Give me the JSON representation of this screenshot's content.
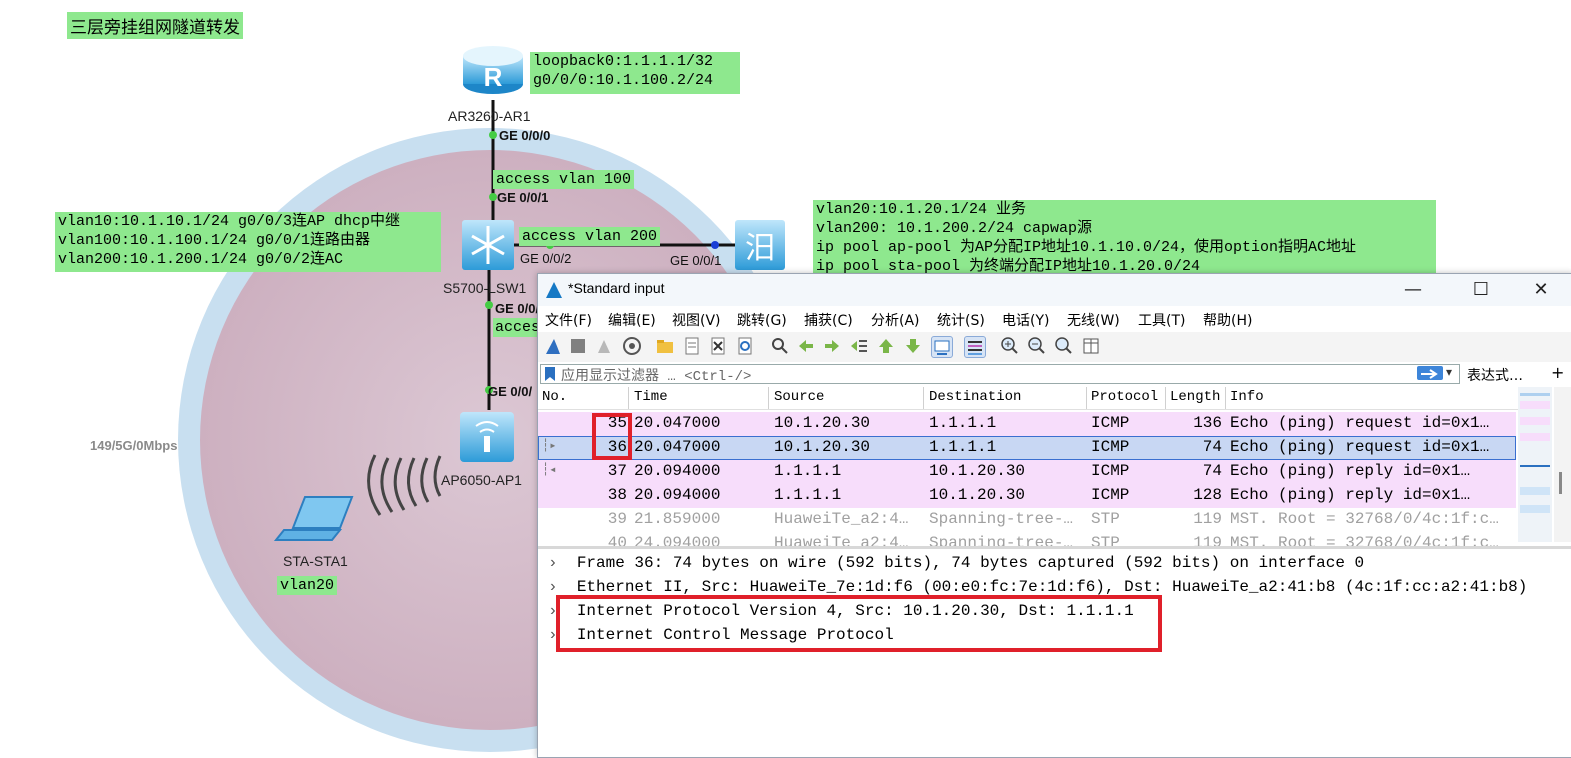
{
  "diagram": {
    "title": "三层旁挂组网隧道转发",
    "router": {
      "name": "AR3260-AR1",
      "config_lines": [
        "loopback0:1.1.1.1/32",
        "g0/0/0:10.1.100.2/24"
      ],
      "port": "GE 0/0/0"
    },
    "link_router_switch": {
      "label": "access vlan 100"
    },
    "switch": {
      "name": "S5700-LSW1",
      "port_up": "GE 0/0/1",
      "port_ac": "GE 0/0/2",
      "port_down": "GE 0/0/",
      "config_lines": [
        "vlan10:10.1.10.1/24 g0/0/3连AP dhcp中继",
        "vlan100:10.1.100.1/24 g0/0/1连路由器",
        "vlan200:10.1.200.1/24 g0/0/2连AC"
      ]
    },
    "link_switch_ac": {
      "label": "access vlan 200"
    },
    "ac": {
      "port": "GE 0/0/1",
      "config_lines": [
        "vlan20:10.1.20.1/24 业务",
        "vlan200: 10.1.200.2/24 capwap源",
        "ip pool ap-pool 为AP分配IP地址10.1.10.0/24，使用option指明AC地址",
        "ip pool sta-pool 为终端分配IP地址10.1.20.0/24"
      ]
    },
    "link_switch_ap": {
      "label": "acces",
      "port": "GE 0/0/"
    },
    "ap": {
      "name": "AP6050-AP1"
    },
    "wireless_info": "149/5G/0Mbps",
    "station": {
      "name": "STA-STA1",
      "vlan_label": "vlan20"
    }
  },
  "wireshark": {
    "title": "*Standard input",
    "window_buttons": {
      "minimize": "—",
      "maximize": "☐",
      "close": "✕"
    },
    "menu": [
      "文件(F)",
      "编辑(E)",
      "视图(V)",
      "跳转(G)",
      "捕获(C)",
      "分析(A)",
      "统计(S)",
      "电话(Y)",
      "无线(W)",
      "工具(T)",
      "帮助(H)"
    ],
    "filter": {
      "placeholder": "应用显示过滤器 … <Ctrl-/>",
      "expression_label": "表达式…",
      "plus": "+"
    },
    "columns": [
      "No.",
      "Time",
      "Source",
      "Destination",
      "Protocol",
      "Length",
      "Info"
    ],
    "packets": [
      {
        "no": "35",
        "time": "20.047000",
        "source": "10.1.20.30",
        "destination": "1.1.1.1",
        "protocol": "ICMP",
        "length": "136",
        "info": "Echo (ping) request  id=0x1…",
        "style": "icmp"
      },
      {
        "no": "36",
        "time": "20.047000",
        "source": "10.1.20.30",
        "destination": "1.1.1.1",
        "protocol": "ICMP",
        "length": "74",
        "info": "Echo (ping) request  id=0x1…",
        "style": "selected"
      },
      {
        "no": "37",
        "time": "20.094000",
        "source": "1.1.1.1",
        "destination": "10.1.20.30",
        "protocol": "ICMP",
        "length": "74",
        "info": "Echo (ping) reply    id=0x1…",
        "style": "icmp"
      },
      {
        "no": "38",
        "time": "20.094000",
        "source": "1.1.1.1",
        "destination": "10.1.20.30",
        "protocol": "ICMP",
        "length": "128",
        "info": "Echo (ping) reply    id=0x1…",
        "style": "icmp"
      },
      {
        "no": "39",
        "time": "21.859000",
        "source": "HuaweiTe_a2:4…",
        "destination": "Spanning-tree-…",
        "protocol": "STP",
        "length": "119",
        "info": "MST. Root = 32768/0/4c:1f:c…",
        "style": "stp"
      },
      {
        "no": "40",
        "time": "24.094000",
        "source": "HuaweiTe_a2:4…",
        "destination": "Spanning-tree-…",
        "protocol": "STP",
        "length": "119",
        "info": "MST. Root = 32768/0/4c:1f:c…",
        "style": "stp"
      }
    ],
    "details": [
      "Frame 36: 74 bytes on wire (592 bits), 74 bytes captured (592 bits) on interface 0",
      "Ethernet II, Src: HuaweiTe_7e:1d:f6 (00:e0:fc:7e:1d:f6), Dst: HuaweiTe_a2:41:b8 (4c:1f:cc:a2:41:b8)",
      "Internet Protocol Version 4, Src: 10.1.20.30, Dst: 1.1.1.1",
      "Internet Control Message Protocol"
    ],
    "colors": {
      "icmp_row": "#f7ddfb",
      "selected_row": "#c8d7f3",
      "stp_text": "#a0a0a0",
      "highlight": "#e0202a"
    }
  }
}
